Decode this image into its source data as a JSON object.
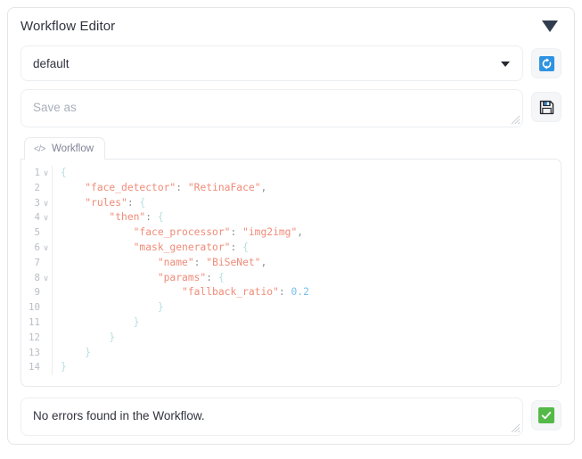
{
  "panel": {
    "title": "Workflow Editor",
    "collapse_icon": "triangle-down-icon"
  },
  "workflow_select": {
    "value": "default",
    "caret_icon": "caret-down-icon",
    "reload_button": {
      "icon": "refresh-icon",
      "color": "#2f93e0"
    }
  },
  "save_as": {
    "placeholder": "Save as",
    "value": "",
    "save_button": {
      "icon": "floppy-disk-save-icon"
    }
  },
  "editor": {
    "tab_label": "Workflow",
    "tab_icon": "code-brackets-icon",
    "lines": [
      {
        "num": "1",
        "fold": true,
        "segments": [
          {
            "t": "{",
            "c": "punc"
          }
        ]
      },
      {
        "num": "2",
        "fold": false,
        "segments": [
          {
            "t": "    ",
            "c": "plain"
          },
          {
            "t": "\"face_detector\"",
            "c": "key"
          },
          {
            "t": ":",
            "c": "col"
          },
          {
            "t": " ",
            "c": "plain"
          },
          {
            "t": "\"RetinaFace\"",
            "c": "str"
          },
          {
            "t": ",",
            "c": "col"
          }
        ]
      },
      {
        "num": "3",
        "fold": true,
        "segments": [
          {
            "t": "    ",
            "c": "plain"
          },
          {
            "t": "\"rules\"",
            "c": "key"
          },
          {
            "t": ":",
            "c": "col"
          },
          {
            "t": " ",
            "c": "plain"
          },
          {
            "t": "{",
            "c": "punc"
          }
        ]
      },
      {
        "num": "4",
        "fold": true,
        "segments": [
          {
            "t": "        ",
            "c": "plain"
          },
          {
            "t": "\"then\"",
            "c": "key"
          },
          {
            "t": ":",
            "c": "col"
          },
          {
            "t": " ",
            "c": "plain"
          },
          {
            "t": "{",
            "c": "punc"
          }
        ]
      },
      {
        "num": "5",
        "fold": false,
        "segments": [
          {
            "t": "            ",
            "c": "plain"
          },
          {
            "t": "\"face_processor\"",
            "c": "key"
          },
          {
            "t": ":",
            "c": "col"
          },
          {
            "t": " ",
            "c": "plain"
          },
          {
            "t": "\"img2img\"",
            "c": "str"
          },
          {
            "t": ",",
            "c": "col"
          }
        ]
      },
      {
        "num": "6",
        "fold": true,
        "segments": [
          {
            "t": "            ",
            "c": "plain"
          },
          {
            "t": "\"mask_generator\"",
            "c": "key"
          },
          {
            "t": ":",
            "c": "col"
          },
          {
            "t": " ",
            "c": "plain"
          },
          {
            "t": "{",
            "c": "punc"
          }
        ]
      },
      {
        "num": "7",
        "fold": false,
        "segments": [
          {
            "t": "                ",
            "c": "plain"
          },
          {
            "t": "\"name\"",
            "c": "key"
          },
          {
            "t": ":",
            "c": "col"
          },
          {
            "t": " ",
            "c": "plain"
          },
          {
            "t": "\"BiSeNet\"",
            "c": "str"
          },
          {
            "t": ",",
            "c": "col"
          }
        ]
      },
      {
        "num": "8",
        "fold": true,
        "segments": [
          {
            "t": "                ",
            "c": "plain"
          },
          {
            "t": "\"params\"",
            "c": "key"
          },
          {
            "t": ":",
            "c": "col"
          },
          {
            "t": " ",
            "c": "plain"
          },
          {
            "t": "{",
            "c": "punc"
          }
        ]
      },
      {
        "num": "9",
        "fold": false,
        "segments": [
          {
            "t": "                    ",
            "c": "plain"
          },
          {
            "t": "\"fallback_ratio\"",
            "c": "key"
          },
          {
            "t": ":",
            "c": "col"
          },
          {
            "t": " ",
            "c": "plain"
          },
          {
            "t": "0.2",
            "c": "num"
          }
        ]
      },
      {
        "num": "10",
        "fold": false,
        "segments": [
          {
            "t": "                ",
            "c": "plain"
          },
          {
            "t": "}",
            "c": "punc"
          }
        ]
      },
      {
        "num": "11",
        "fold": false,
        "segments": [
          {
            "t": "            ",
            "c": "plain"
          },
          {
            "t": "}",
            "c": "punc"
          }
        ]
      },
      {
        "num": "12",
        "fold": false,
        "segments": [
          {
            "t": "        ",
            "c": "plain"
          },
          {
            "t": "}",
            "c": "punc"
          }
        ]
      },
      {
        "num": "13",
        "fold": false,
        "segments": [
          {
            "t": "    ",
            "c": "plain"
          },
          {
            "t": "}",
            "c": "punc"
          }
        ]
      },
      {
        "num": "14",
        "fold": false,
        "segments": [
          {
            "t": "}",
            "c": "punc"
          }
        ]
      }
    ]
  },
  "status": {
    "message": "No errors found in the Workflow.",
    "validate_button": {
      "icon": "check-mark-icon",
      "color": "#54b948"
    }
  },
  "colors": {
    "panel_border": "#e6e6e6",
    "text": "#31333f",
    "muted": "#a9b0bb",
    "json_key": "#ef8b78",
    "json_number": "#79c0e8",
    "json_punc": "#b8dfe0",
    "accent_blue": "#2f93e0",
    "accent_green": "#54b948"
  }
}
